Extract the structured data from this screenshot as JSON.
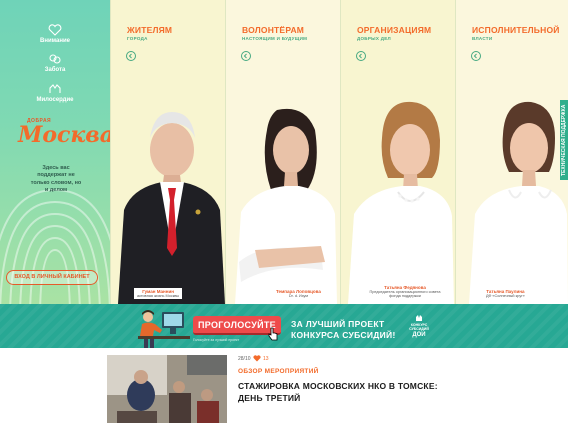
{
  "sidebar": {
    "items": [
      {
        "label": "Внимание",
        "icon": "heart-icon"
      },
      {
        "label": "Забота",
        "icon": "care-icon"
      },
      {
        "label": "Милосердие",
        "icon": "hands-icon"
      }
    ],
    "logo_small": "ДОБРАЯ",
    "logo": "Москва",
    "tagline": "Здесь вас поддержат не только словом, но и делом",
    "cabinet_button": "ВХОД В ЛИЧНЫЙ КАБИНЕТ"
  },
  "columns": [
    {
      "title": "ЖИТЕЛЯМ",
      "subtitle": "ГОРОДА",
      "name": "Гуман Маннин",
      "desc": "активная жизнь Москвы"
    },
    {
      "title": "ВОЛОНТЁРАМ",
      "subtitle": "НАСТОЯЩИМ И БУДУЩИМ",
      "name": "Темпара Лоповцова",
      "desc": "Dr. d. Изум"
    },
    {
      "title": "ОРГАНИЗАЦИЯМ",
      "subtitle": "ДОБРЫХ ДЕЛ",
      "name": "Татьяна Федянова",
      "desc": "Председатель организационного совета фонда поддержки"
    },
    {
      "title": "ИСПОЛНИТЕЛЬНОЙ",
      "subtitle": "ВЛАСТИ",
      "name": "Татьяна Паулина",
      "desc": "ДФ «Солнечный круг»"
    }
  ],
  "support_tab": "ТЕХНИЧЕСКАЯ ПОДДЕРЖКА",
  "banner": {
    "vote_button": "ПРОГОЛОСУЙТЕ",
    "vote_under": "Голосуйте за лучший проект",
    "line1": "ЗА ЛУЧШИЙ ПРОЕКТ",
    "line2": "КОНКУРСА СУБСИДИЙ!",
    "logo_text": "КОНКУРС СУБСИДИЙ",
    "logo_mark": "ДОИ"
  },
  "news": {
    "date": "28/10",
    "likes": "13",
    "category": "ОБЗОР МЕРОПРИЯТИЙ",
    "title": "СТАЖИРОВКА МОСКОВСКИХ НКО В ТОМСКЕ: ДЕНЬ ТРЕТИЙ"
  },
  "colors": {
    "accent": "#f36b2b",
    "green": "#46a982",
    "banner": "#27a894",
    "vote": "#ee4b4b"
  }
}
